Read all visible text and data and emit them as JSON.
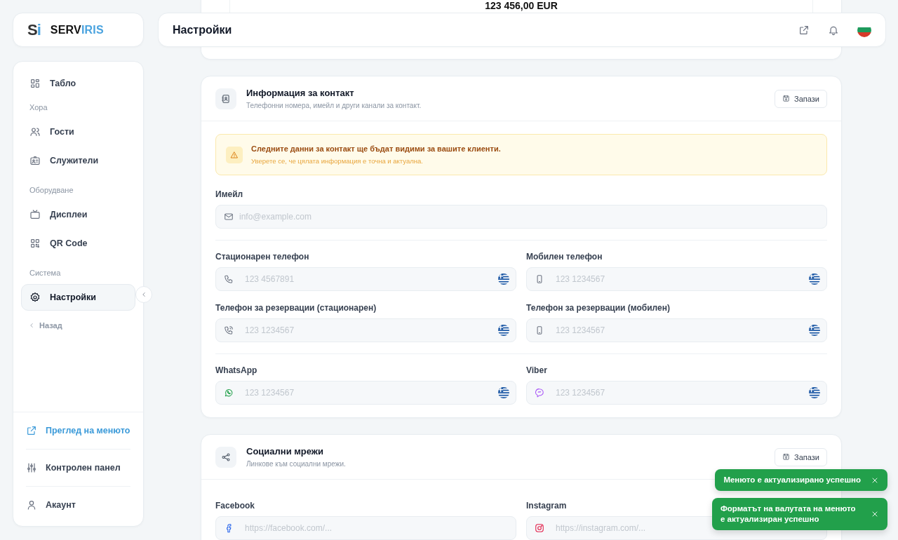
{
  "logo": {
    "mark": [
      "S",
      "i"
    ],
    "name": [
      "SERV",
      "IRIS"
    ]
  },
  "nav": [
    {
      "kind": "item",
      "label": "Табло",
      "selected": false
    },
    {
      "kind": "section",
      "label": "Хора"
    },
    {
      "kind": "item",
      "label": "Гости",
      "selected": false
    },
    {
      "kind": "item",
      "label": "Служители",
      "selected": false
    },
    {
      "kind": "section",
      "label": "Оборудване"
    },
    {
      "kind": "item",
      "label": "Дисплеи",
      "selected": false
    },
    {
      "kind": "item",
      "label": "QR Code",
      "selected": false
    },
    {
      "kind": "section",
      "label": "Система"
    },
    {
      "kind": "item",
      "label": "Настройки",
      "selected": true
    },
    {
      "kind": "back",
      "label": "Назад"
    }
  ],
  "sidebar_footer": [
    {
      "kind": "link",
      "label": "Преглед на менюто"
    },
    {
      "kind": "item",
      "label": "Контролен панел"
    },
    {
      "kind": "item",
      "label": "Акаунт"
    }
  ],
  "header": {
    "title": "Настройки"
  },
  "summary_card": {
    "amount": "123 456,00 EUR"
  },
  "sections": [
    {
      "title": "Информация за контакт",
      "subtitle": "Телефонни номера, имейл и други канали за контакт.",
      "save_label": "Запази",
      "alert": {
        "title": "Следните данни за контакт ще бъдат видими за вашите клиенти.",
        "text": "Уверете се, че цялата информация е точна и актуална."
      },
      "groups": [
        [
          [
            {
              "kind": "email",
              "label": "Имейл",
              "placeholder": "info@example.com"
            }
          ]
        ],
        [
          [
            {
              "kind": "landline",
              "label": "Стационарен телефон",
              "placeholder": "123 4567891"
            },
            {
              "kind": "mobile",
              "label": "Мобилен телефон",
              "placeholder": "123 1234567"
            }
          ],
          [
            {
              "kind": "reservation",
              "label": "Телефон за резервации (стационарен)",
              "placeholder": "123 1234567"
            },
            {
              "kind": "mobile",
              "label": "Телефон за резервации (мобилен)",
              "placeholder": "123 1234567"
            }
          ]
        ],
        [
          [
            {
              "kind": "whatsapp",
              "label": "WhatsApp",
              "placeholder": "123 1234567"
            },
            {
              "kind": "viber",
              "label": "Viber",
              "placeholder": "123 1234567"
            }
          ]
        ]
      ]
    },
    {
      "title": "Социални мрежи",
      "subtitle": "Линкове към социални мрежи.",
      "save_label": "Запази",
      "groups": [
        [
          [
            {
              "kind": "facebook",
              "label": "Facebook",
              "placeholder": "https://facebook.com/..."
            },
            {
              "kind": "instagram",
              "label": "Instagram",
              "placeholder": "https://instagram.com/..."
            }
          ]
        ]
      ]
    }
  ],
  "toasts": [
    {
      "text": "Менюто е актуализирано успешно"
    },
    {
      "text": "Форматът на валутата на менюто е актуализиран успешно"
    }
  ]
}
